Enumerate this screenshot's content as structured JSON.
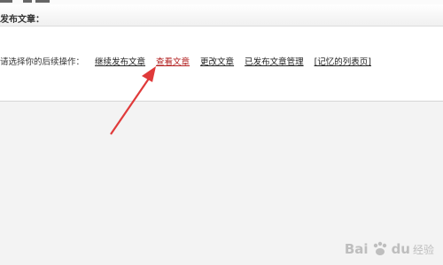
{
  "header": {
    "title": "发布文章："
  },
  "actions": {
    "prompt": "请选择你的后续操作：",
    "links": [
      {
        "label": "继续发布文章"
      },
      {
        "label": "查看文章",
        "highlighted": true
      },
      {
        "label": "更改文章"
      },
      {
        "label": "已发布文章管理"
      },
      {
        "label": "[记忆的列表页]"
      }
    ]
  },
  "annotation": {
    "arrow_color": "#e03a3a"
  },
  "watermark": {
    "brand": "Bai",
    "brand_tail": "du",
    "suffix": "经验"
  },
  "colors": {
    "highlight_link": "#b21f1f",
    "arrow": "#e03a3a"
  }
}
